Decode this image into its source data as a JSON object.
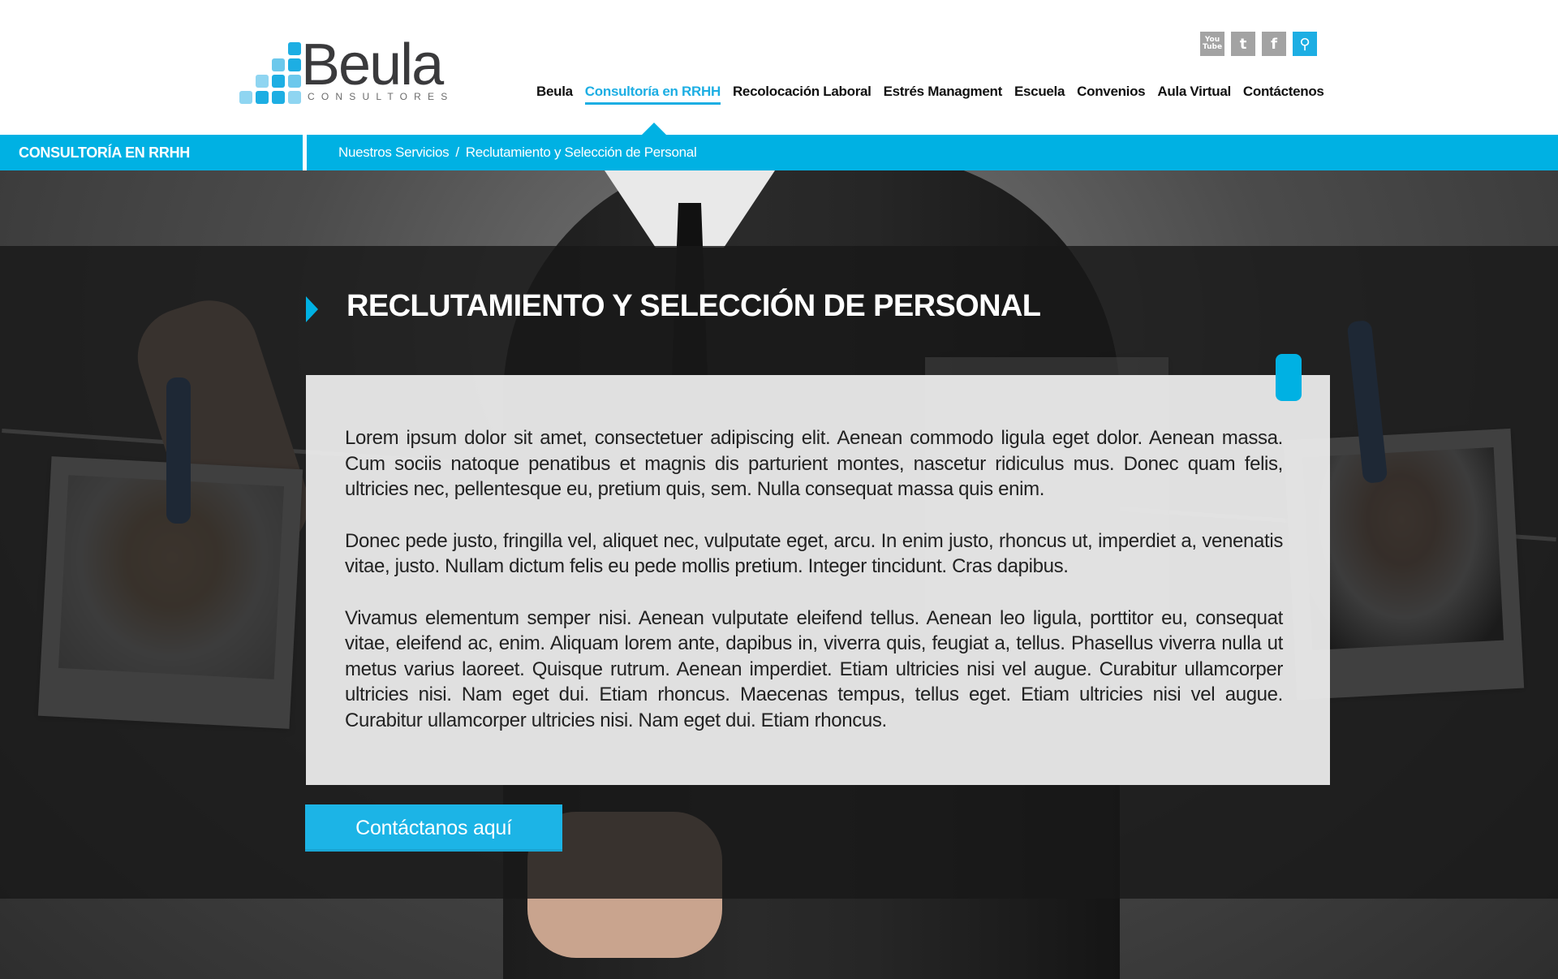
{
  "brand": {
    "name": "Beula",
    "tagline": "CONSULTORES"
  },
  "social": [
    {
      "icon": "youtube-icon",
      "label": "You Tube"
    },
    {
      "icon": "twitter-icon",
      "label": "t"
    },
    {
      "icon": "facebook-icon",
      "label": "f"
    },
    {
      "icon": "search-icon",
      "label": "⚲"
    }
  ],
  "nav": {
    "items": [
      {
        "label": "Beula",
        "active": false
      },
      {
        "label": "Consultoría en RRHH",
        "active": true
      },
      {
        "label": "Recolocación Laboral",
        "active": false
      },
      {
        "label": "Estrés Managment",
        "active": false
      },
      {
        "label": "Escuela",
        "active": false
      },
      {
        "label": "Convenios",
        "active": false
      },
      {
        "label": "Aula Virtual",
        "active": false
      },
      {
        "label": "Contáctenos",
        "active": false
      }
    ]
  },
  "bar": {
    "section": "CONSULTORÍA EN RRHH",
    "breadcrumb": [
      "Nuestros Servicios",
      "/",
      "Reclutamiento y Selección de Personal"
    ]
  },
  "main": {
    "title": "RECLUTAMIENTO Y SELECCIÓN DE PERSONAL",
    "paragraphs": [
      "Lorem ipsum dolor sit amet, consectetuer adipiscing elit. Aenean commodo ligula eget dolor. Aenean massa. Cum sociis natoque penatibus et magnis dis parturient montes, nascetur ridiculus mus. Donec quam felis, ultricies nec, pellentesque eu, pretium quis, sem. Nulla consequat massa quis enim.",
      "Donec pede justo, fringilla vel, aliquet nec, vulputate eget, arcu. In enim justo, rhoncus ut, imperdiet a, venenatis vitae, justo. Nullam dictum felis eu pede mollis pretium. Integer tincidunt. Cras dapibus.",
      "Vivamus elementum semper nisi. Aenean vulputate eleifend tellus. Aenean leo ligula, porttitor eu, consequat vitae, eleifend ac, enim. Aliquam lorem ante, dapibus in, viverra quis, feugiat a, tellus. Phasellus viverra nulla ut metus varius laoreet. Quisque rutrum. Aenean imperdiet. Etiam ultricies nisi vel augue. Curabitur ullamcorper ultricies nisi. Nam eget dui. Etiam rhoncus. Maecenas tempus, tellus eget. Etiam ultricies nisi vel augue. Curabitur ullamcorper ultricies nisi. Nam eget dui. Etiam rhoncus."
    ],
    "cta_label": "Contáctanos aquí"
  },
  "colors": {
    "accent": "#00b1e3",
    "text": "#222222",
    "panel": "#181818"
  }
}
